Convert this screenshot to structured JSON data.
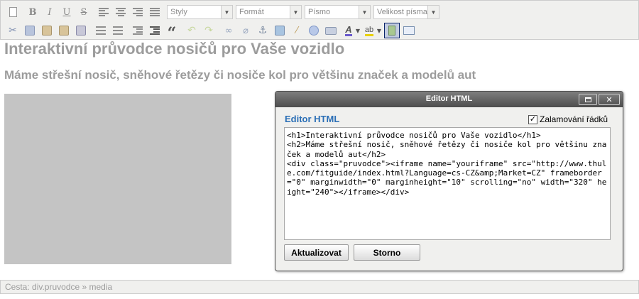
{
  "toolbar": {
    "styles_select": "Styly",
    "format_select": "Formát",
    "font_select": "Písmo",
    "size_select": "Velikost písma",
    "bold_label": "B",
    "italic_label": "I",
    "underline_label": "U",
    "strike_label": "S",
    "quote_label": "“"
  },
  "content": {
    "h1": "Interaktivní průvodce nosičů pro Vaše vozidlo",
    "h2": "Máme střešní nosič, sněhové řetězy či nosiče kol pro většinu značek a modelů aut"
  },
  "statusbar": {
    "path": "Cesta: div.pruvodce » media"
  },
  "dialog": {
    "title": "Editor HTML",
    "heading": "Editor HTML",
    "wrap_label": "Zalamování řádků",
    "wrap_checked": true,
    "code": "<h1>Interaktivní průvodce nosičů pro Vaše vozidlo</h1>\n<h2>Máme střešní nosič, sněhové řetězy či nosiče kol pro většinu značek a modelů aut</h2>\n<div class=\"pruvodce\"><iframe name=\"youriframe\" src=\"http://www.thule.com/fitguide/index.html?Language=cs-CZ&amp;Market=CZ\" frameborder=\"0\" marginwidth=\"0\" marginheight=\"10\" scrolling=\"no\" width=\"320\" height=\"240\"></iframe></div>",
    "update_button": "Aktualizovat",
    "cancel_button": "Storno",
    "close_symbol": "✕"
  },
  "colors": {
    "heading_gray": "#9c9c9c",
    "toolbar_bg": "#f0f0ee",
    "dialog_title_bg": "#5a5a5a",
    "dialog_heading_blue": "#2b6fb6",
    "iframe_placeholder": "#c4c4c4"
  }
}
